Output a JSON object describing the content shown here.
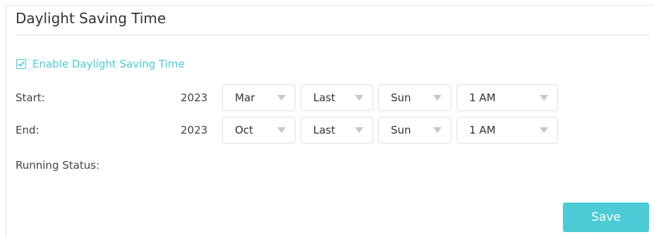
{
  "section": {
    "title": "Daylight Saving Time"
  },
  "enable": {
    "label": "Enable Daylight Saving Time",
    "checked": true,
    "accent_color": "#4acbd6"
  },
  "start": {
    "label": "Start:",
    "year": "2023",
    "month": "Mar",
    "week": "Last",
    "day": "Sun",
    "time": "1 AM"
  },
  "end": {
    "label": "End:",
    "year": "2023",
    "month": "Oct",
    "week": "Last",
    "day": "Sun",
    "time": "1 AM"
  },
  "status": {
    "label": "Running Status:"
  },
  "actions": {
    "save_label": "Save",
    "save_color": "#4acbd6"
  }
}
